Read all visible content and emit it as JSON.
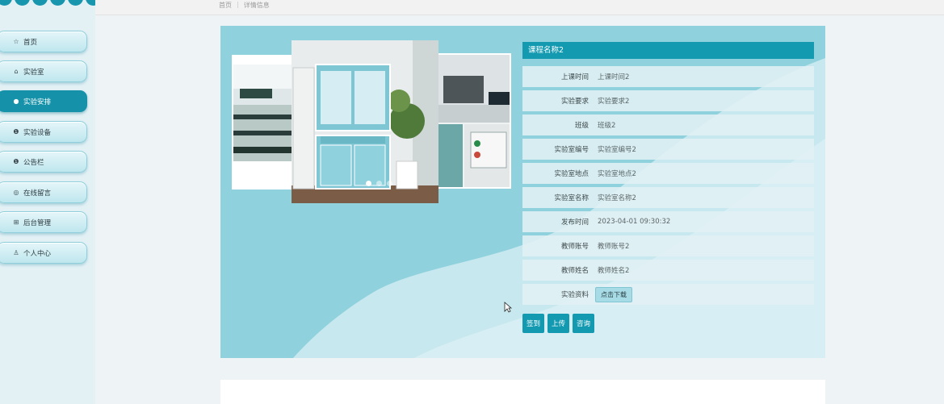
{
  "sidebar": {
    "items": [
      {
        "label": "首页",
        "icon": "star-icon",
        "glyph": "☆",
        "active": false
      },
      {
        "label": "实验室",
        "icon": "bag-icon",
        "glyph": "⌂",
        "active": false
      },
      {
        "label": "实验安排",
        "icon": "dot-icon",
        "glyph": "●",
        "active": true
      },
      {
        "label": "实验设备",
        "icon": "info-icon",
        "glyph": "❶",
        "active": false
      },
      {
        "label": "公告栏",
        "icon": "notice-icon",
        "glyph": "❶",
        "active": false
      },
      {
        "label": "在线留言",
        "icon": "chat-icon",
        "glyph": "◎",
        "active": false
      },
      {
        "label": "后台管理",
        "icon": "admin-icon",
        "glyph": "⊞",
        "active": false
      },
      {
        "label": "个人中心",
        "icon": "user-icon",
        "glyph": "♙",
        "active": false
      }
    ]
  },
  "breadcrumb": {
    "home": "首页",
    "separator": "|",
    "current": "详情信息"
  },
  "detail": {
    "title": "课程名称2",
    "rows": [
      {
        "label": "上课时间",
        "value": "上课时间2"
      },
      {
        "label": "实验要求",
        "value": "实验要求2"
      },
      {
        "label": "班级",
        "value": "班级2"
      },
      {
        "label": "实验室编号",
        "value": "实验室编号2"
      },
      {
        "label": "实验室地点",
        "value": "实验室地点2"
      },
      {
        "label": "实验室名称",
        "value": "实验室名称2"
      },
      {
        "label": "发布时间",
        "value": "2023-04-01 09:30:32"
      },
      {
        "label": "教师账号",
        "value": "教师账号2"
      },
      {
        "label": "教师姓名",
        "value": "教师姓名2"
      }
    ],
    "material": {
      "label": "实验资料",
      "button": "点击下载"
    },
    "actions": {
      "checkin": "签到",
      "upload": "上传",
      "consult": "咨询"
    }
  },
  "gallery": {
    "slides": 3,
    "active_slide": 1
  },
  "colors": {
    "accent": "#139ab1",
    "card_bg": "#8fd1dc",
    "sidebar_bg": "#e3f1f5"
  }
}
